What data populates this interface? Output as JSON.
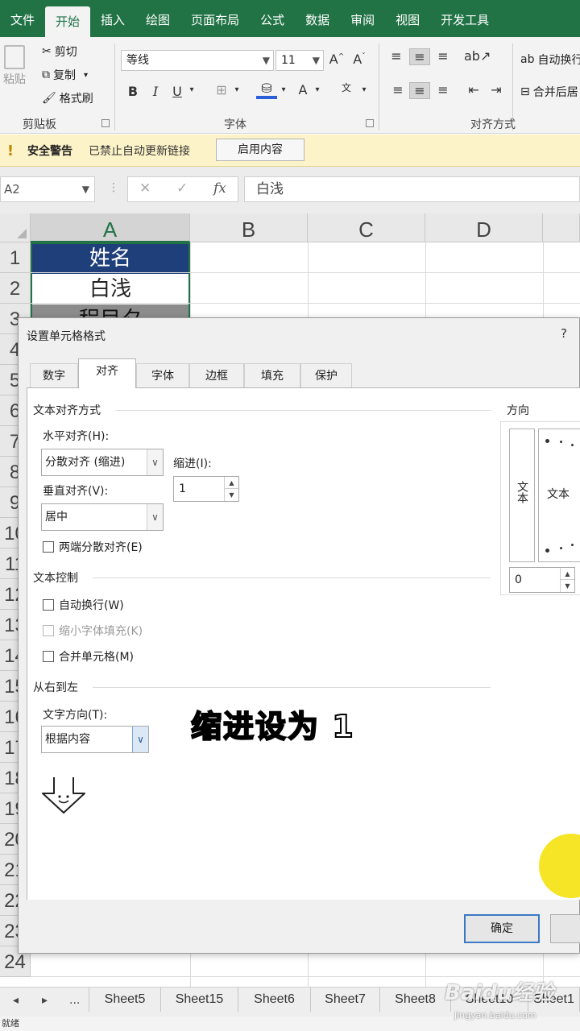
{
  "ribbon": {
    "tabs": [
      "文件",
      "开始",
      "插入",
      "绘图",
      "页面布局",
      "公式",
      "数据",
      "审阅",
      "视图",
      "开发工具"
    ],
    "active_tab": "开始",
    "clipboard": {
      "paste": "粘贴",
      "cut": "剪切",
      "copy": "复制",
      "format_painter": "格式刷",
      "group": "剪贴板"
    },
    "font": {
      "name": "等线",
      "size": "11",
      "group": "字体"
    },
    "alignment": {
      "wrap": "自动换行",
      "merge": "合并后居",
      "group": "对齐方式"
    }
  },
  "security": {
    "title": "安全警告",
    "message": "已禁止自动更新链接",
    "button": "启用内容"
  },
  "formula_bar": {
    "name_box": "A2",
    "value": "白浅"
  },
  "sheet": {
    "columns": [
      "A",
      "B",
      "C",
      "D"
    ],
    "rows": [
      "1",
      "2",
      "3",
      "4",
      "5",
      "6",
      "7",
      "8",
      "9",
      "10",
      "11",
      "12",
      "13",
      "14",
      "15",
      "16",
      "17",
      "18",
      "19",
      "20",
      "21",
      "22",
      "23",
      "24"
    ],
    "cells": [
      {
        "value": "姓名"
      },
      {
        "value": "白浅"
      },
      {
        "value": "程目夕"
      }
    ]
  },
  "dialog": {
    "title": "设置单元格格式",
    "help": "?",
    "tabs": [
      "数字",
      "对齐",
      "字体",
      "边框",
      "填充",
      "保护"
    ],
    "active_tab": "对齐",
    "text_alignment": {
      "section": "文本对齐方式",
      "horizontal_label": "水平对齐(H):",
      "horizontal_value": "分散对齐 (缩进)",
      "indent_label": "缩进(I):",
      "indent_value": "1",
      "vertical_label": "垂直对齐(V):",
      "vertical_value": "居中",
      "justify_distributed": "两端分散对齐(E)"
    },
    "text_control": {
      "section": "文本控制",
      "wrap": "自动换行(W)",
      "shrink": "缩小字体填充(K)",
      "merge": "合并单元格(M)"
    },
    "rtl": {
      "section": "从右到左",
      "direction_label": "文字方向(T):",
      "direction_value": "根据内容"
    },
    "orientation": {
      "label": "方向",
      "vertical_text": "文本",
      "dial_text": "文本",
      "degrees": "0"
    },
    "ok": "确定"
  },
  "annotation": "缩进设为 1",
  "sheet_tabs": {
    "nav": [
      "◂",
      "▸",
      "..."
    ],
    "tabs": [
      "Sheet5",
      "Sheet15",
      "Sheet6",
      "Sheet7",
      "Sheet8",
      "Sheet10",
      "Sheet1"
    ]
  },
  "status": "就绪",
  "watermark": {
    "logo": "Baidu经验",
    "url": "jingyan.baidu.com"
  },
  "colors": {
    "excel_green": "#217346",
    "header_blue": "#1f3f7a",
    "alt_row_gray": "#8c8c8c",
    "security_yellow": "#fdf3c8"
  }
}
